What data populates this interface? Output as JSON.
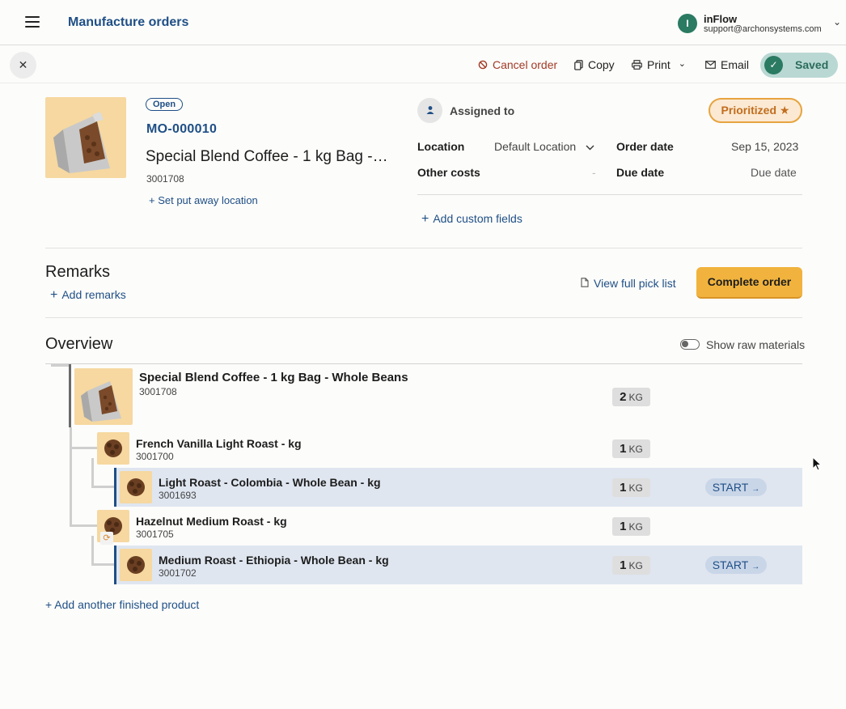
{
  "header": {
    "title": "Manufacture orders",
    "account": {
      "avatar_letter": "I",
      "name": "inFlow",
      "email": "support@archonsystems.com",
      "chevron": "⌄"
    }
  },
  "toolbar": {
    "close": "✕",
    "cancel_label": "Cancel order",
    "copy_label": "Copy",
    "print_label": "Print",
    "print_chevron": "⌄",
    "email_label": "Email",
    "saved_label": "Saved"
  },
  "order": {
    "status": "Open",
    "number": "MO-000010",
    "product_name": "Special Blend Coffee - 1 kg Bag - Whole Beans",
    "sku": "3001708",
    "put_away_link": "+ Set put away location",
    "assigned_label": "Assigned to",
    "priority_label": "Prioritized ★",
    "fields": {
      "location_label": "Location",
      "location_value": "Default Location",
      "other_costs_label": "Other costs",
      "other_costs_value": "-",
      "order_date_label": "Order date",
      "order_date_value": "Sep 15, 2023",
      "due_date_label": "Due date",
      "due_date_value": "Due date"
    },
    "add_custom_fields": "Add custom fields"
  },
  "remarks": {
    "title": "Remarks",
    "add_label": "Add remarks",
    "view_pick_list": "View full pick list",
    "complete_label": "Complete order"
  },
  "overview": {
    "title": "Overview",
    "toggle_label": "Show raw materials",
    "rows": [
      {
        "name": "Special Blend Coffee - 1 kg Bag - Whole Beans",
        "sku": "3001708",
        "qty": "2",
        "uom": "KG"
      },
      {
        "name": "French Vanilla Light Roast - kg",
        "sku": "3001700",
        "qty": "1",
        "uom": "KG"
      },
      {
        "name": "Light Roast - Colombia - Whole Bean - kg",
        "sku": "3001693",
        "qty": "1",
        "uom": "KG",
        "action": "START"
      },
      {
        "name": "Hazelnut Medium Roast - kg",
        "sku": "3001705",
        "qty": "1",
        "uom": "KG"
      },
      {
        "name": "Medium Roast - Ethiopia - Whole Bean - kg",
        "sku": "3001702",
        "qty": "1",
        "uom": "KG",
        "action": "START"
      }
    ],
    "add_another": "+ Add another finished product"
  },
  "colors": {
    "brand_blue": "#1f4f86",
    "accent_orange": "#f1b33d",
    "saved_green": "#2b7a62",
    "cancel_red": "#a23a26"
  }
}
